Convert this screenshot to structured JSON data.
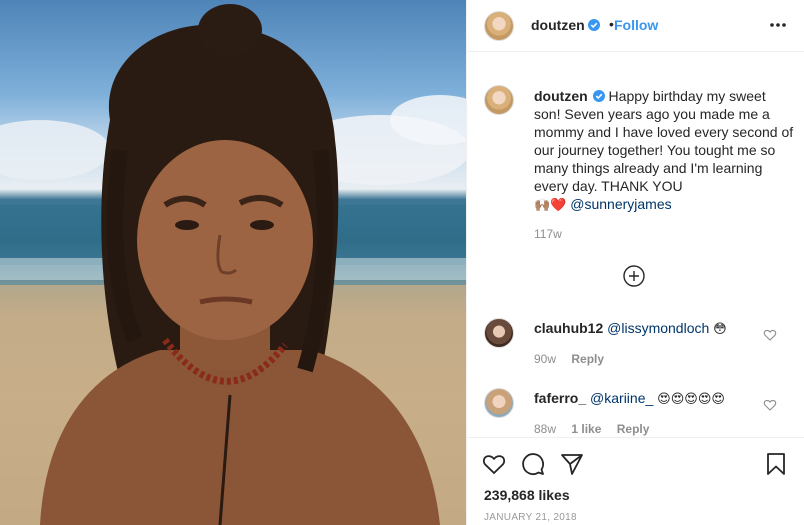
{
  "post": {
    "username": "doutzen",
    "follow_label": "Follow",
    "separator": "•",
    "more_icon": "ellipsis-icon",
    "verified_icon": "verified-badge-icon"
  },
  "caption": {
    "username": "doutzen",
    "text": "Happy birthday my sweet son! Seven years ago you made me a mommy and I have loved every second of our journey together! You tought me so many things already and I'm learning every day. THANK YOU",
    "emojis": "🙌🏽❤️",
    "mention": "@sunneryjames",
    "time": "117w",
    "load_more_icon": "plus-circle-icon"
  },
  "comments": [
    {
      "username": "clauhub12",
      "mention": "@lissymondloch",
      "text": "😳",
      "time": "90w",
      "reply_label": "Reply"
    },
    {
      "username": "faferro_",
      "mention": "@kariine_",
      "text": "😍😍😍😍😍",
      "time": "88w",
      "likes_label": "1 like",
      "reply_label": "Reply"
    }
  ],
  "actions": {
    "like_icon": "heart-icon",
    "comment_icon": "comment-icon",
    "share_icon": "paper-plane-icon",
    "save_icon": "bookmark-icon",
    "likes": "239,868 likes",
    "date": "JANUARY 21, 2018"
  },
  "colors": {
    "link_blue": "#3897f0",
    "text_dark": "#262626",
    "text_muted": "#8e8e8e",
    "mention": "#003569"
  }
}
